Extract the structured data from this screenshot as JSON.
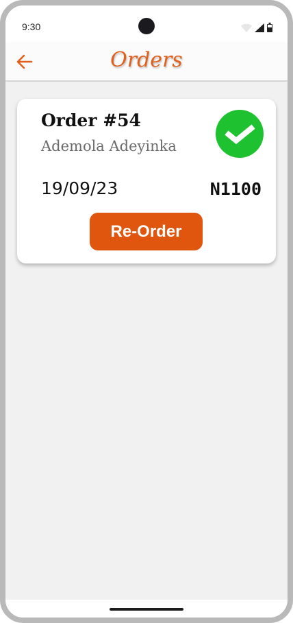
{
  "status_bar": {
    "time": "9:30",
    "icons": [
      "wifi-icon",
      "cellular-signal-icon",
      "battery-icon"
    ]
  },
  "app_bar": {
    "title": "Orders",
    "back_icon": "arrow-left-icon"
  },
  "orders": [
    {
      "order_label": "Order #54",
      "customer_name": "Ademola Adeyinka",
      "date": "19/09/23",
      "amount": "N1100",
      "status_icon": "check-circle-icon",
      "reorder_label": "Re-Order"
    }
  ],
  "colors": {
    "accent": "#e0601c",
    "button": "#e0560f",
    "success": "#1ec12f",
    "background": "#f1f1f1"
  }
}
